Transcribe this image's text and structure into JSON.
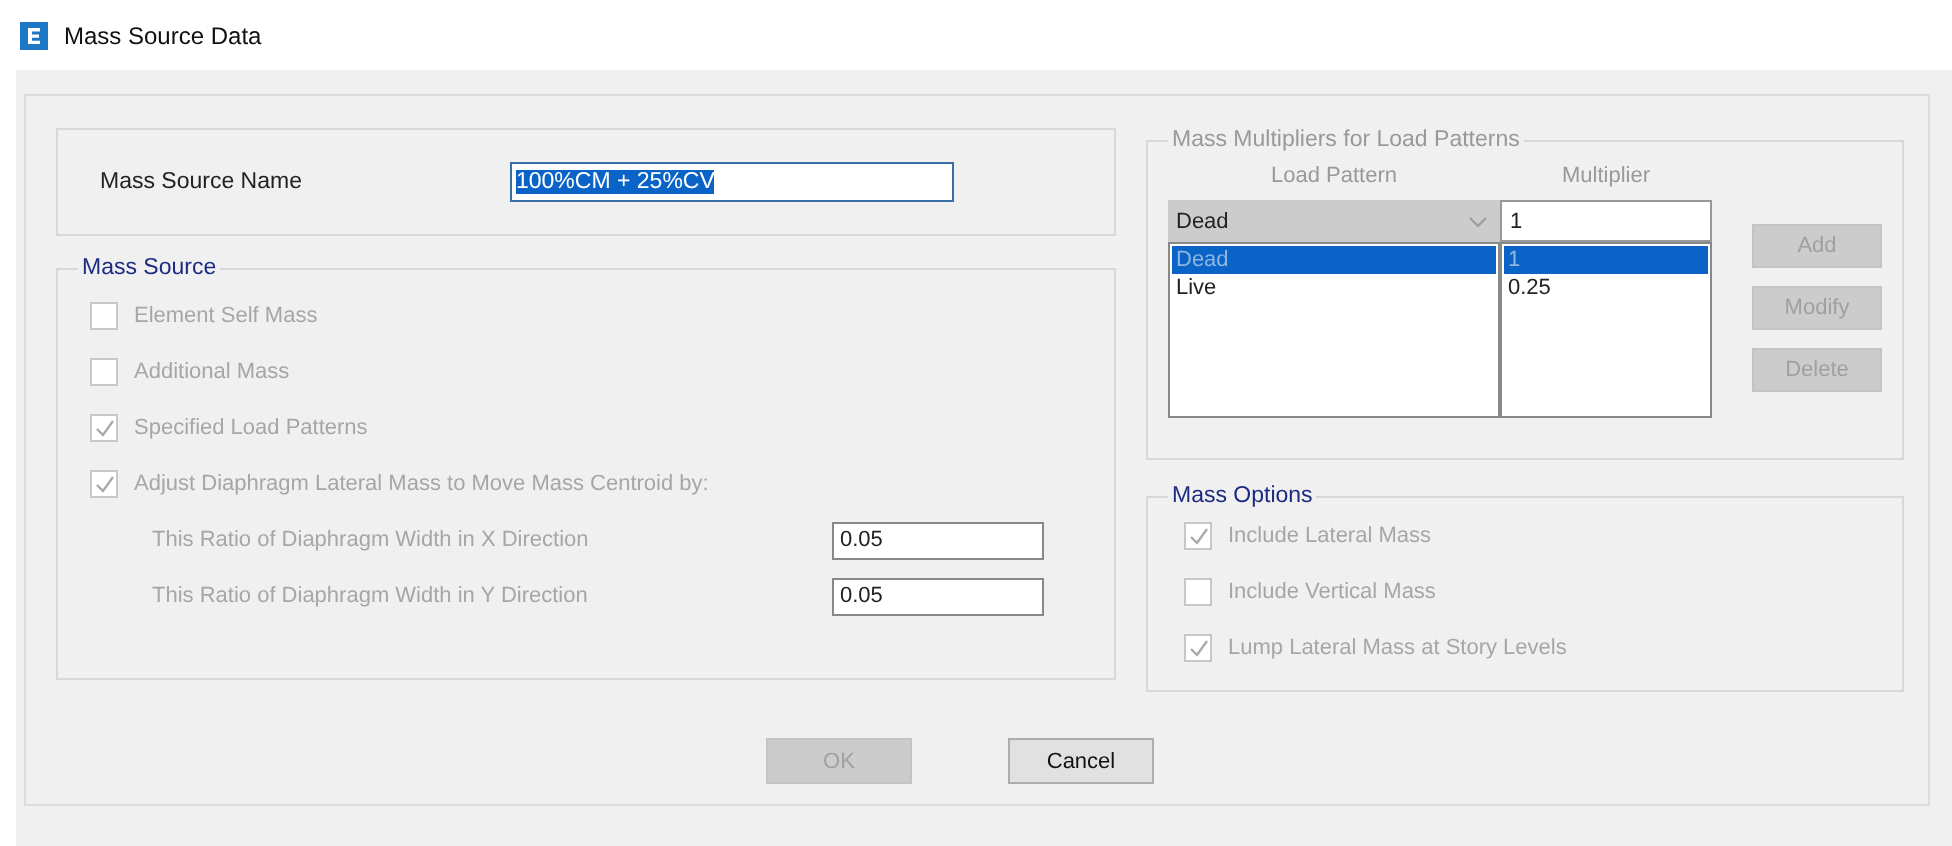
{
  "window": {
    "title": "Mass Source Data"
  },
  "mass_source_name": {
    "label": "Mass Source Name",
    "value": "100%CM + 25%CV"
  },
  "mass_source": {
    "title": "Mass Source",
    "options": [
      {
        "label": "Element Self Mass",
        "checked": false,
        "disabled": true
      },
      {
        "label": "Additional Mass",
        "checked": false,
        "disabled": true
      },
      {
        "label": "Specified Load Patterns",
        "checked": true,
        "disabled": true
      },
      {
        "label": "Adjust Diaphragm Lateral Mass to Move Mass Centroid by:",
        "checked": true,
        "disabled": true
      }
    ],
    "ratios": [
      {
        "label": "This Ratio of Diaphragm Width in X Direction",
        "value": "0.05"
      },
      {
        "label": "This Ratio of Diaphragm Width in Y Direction",
        "value": "0.05"
      }
    ]
  },
  "multipliers": {
    "title": "Mass Multipliers for Load Patterns",
    "column_headers": [
      "Load Pattern",
      "Multiplier"
    ],
    "pattern_dropdown": "Dead",
    "multiplier_value": "1",
    "rows": [
      {
        "pattern": "Dead",
        "multiplier": "1",
        "selected": true
      },
      {
        "pattern": "Live",
        "multiplier": "0.25",
        "selected": false
      }
    ],
    "buttons": [
      {
        "label": "Add",
        "disabled": true
      },
      {
        "label": "Modify",
        "disabled": true
      },
      {
        "label": "Delete",
        "disabled": true
      }
    ]
  },
  "mass_options": {
    "title": "Mass Options",
    "options": [
      {
        "label": "Include Lateral Mass",
        "checked": true,
        "disabled": true
      },
      {
        "label": "Include Vertical Mass",
        "checked": false,
        "disabled": true
      },
      {
        "label": "Lump Lateral Mass at Story Levels",
        "checked": true,
        "disabled": true
      }
    ]
  },
  "buttons": [
    {
      "label": "OK",
      "disabled": true
    },
    {
      "label": "Cancel",
      "disabled": false
    }
  ]
}
